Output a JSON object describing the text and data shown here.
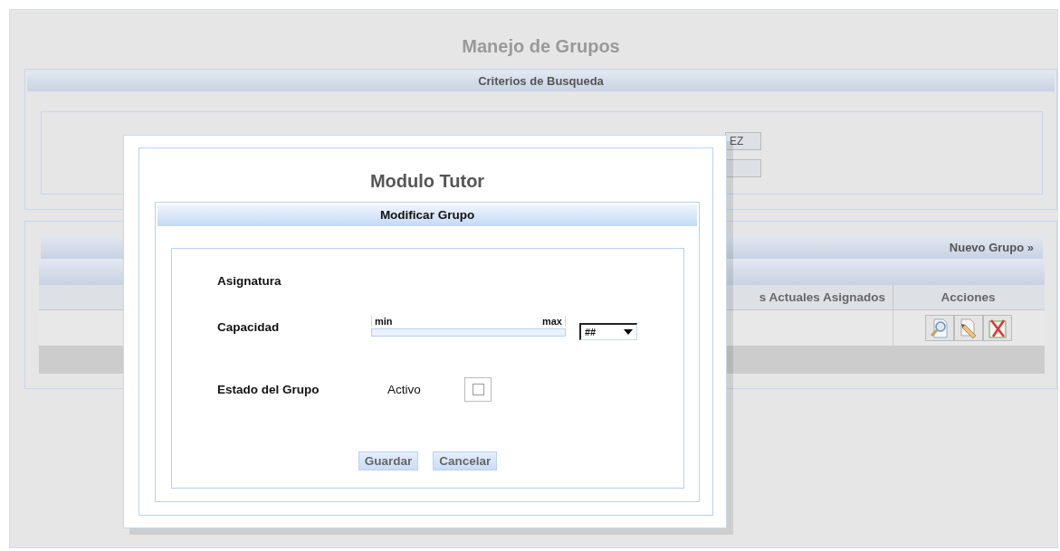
{
  "page": {
    "title": "Manejo de Grupos"
  },
  "search_panel": {
    "header": "Criterios de Busqueda",
    "fields": [
      {
        "kind": "text",
        "value": "EZ"
      },
      {
        "kind": "text"
      }
    ]
  },
  "results_panel": {
    "new_link": "Nuevo Grupo »",
    "columns": [
      "s Actuales Asignados",
      "Acciones"
    ],
    "rows": [
      {
        "actions": [
          {
            "kind": "view"
          },
          {
            "kind": "edit"
          },
          {
            "kind": "delete"
          }
        ]
      }
    ]
  },
  "dialog": {
    "title": "Modulo Tutor",
    "section": "Modificar Grupo",
    "subject_label": "Asignatura",
    "capacity": {
      "label": "Capacidad",
      "min_label": "min",
      "max_label": "max",
      "select_value": "##"
    },
    "status": {
      "label": "Estado del Grupo",
      "option": "Activo",
      "checked": false
    },
    "buttons": [
      "Guardar",
      "Cancelar"
    ]
  }
}
